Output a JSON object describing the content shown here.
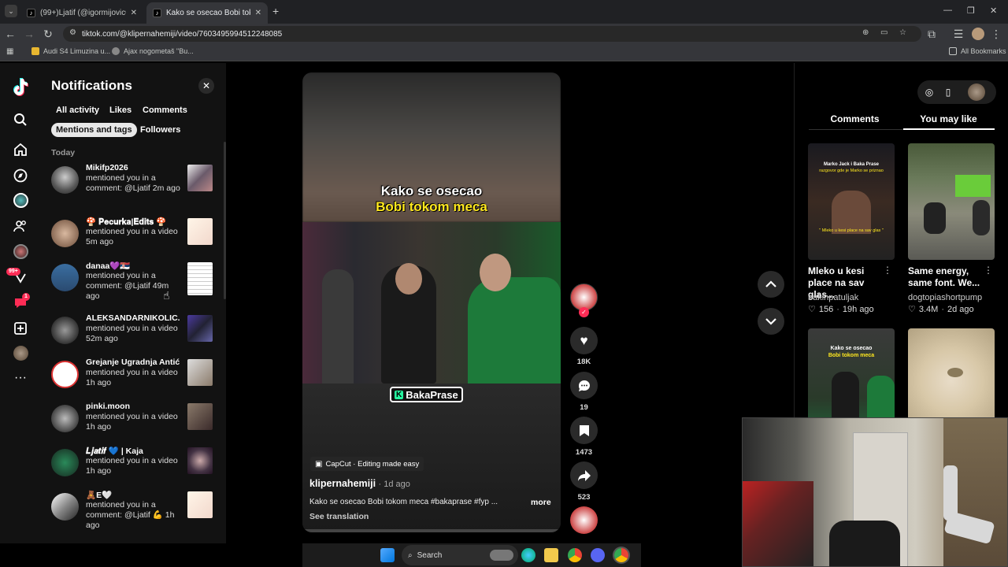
{
  "browser": {
    "tabs": [
      {
        "title": "(99+)Ljatif (@igormijovic00) | T",
        "active": false
      },
      {
        "title": "Kako se osecao Bobi tokom me",
        "active": true
      }
    ],
    "new_tab": "+",
    "url": "tiktok.com/@klipernahemiji/video/7603495994512248085",
    "bookmarks": [
      {
        "label": "Audi S4 Limuzina u..."
      },
      {
        "label": "Ajax nogometaš \"Bu..."
      }
    ],
    "all_bookmarks": "All Bookmarks"
  },
  "rail": {
    "badge_notifications": "99+",
    "badge_messages": "1"
  },
  "notifications": {
    "title": "Notifications",
    "filters": [
      "All activity",
      "Likes",
      "Comments",
      "Mentions and tags",
      "Followers"
    ],
    "selected_filter": "Mentions and tags",
    "section": "Today",
    "items": [
      {
        "name": "Mikifp2026",
        "text": "mentioned you in a comment: @Ljatif 2m ago"
      },
      {
        "name": "🍄 𝐏𝐞𝐜𝐮𝐫𝐤𝐚|𝐄𝐝𝐢𝐭𝐬 🍄",
        "text": "mentioned you in a video 5m ago"
      },
      {
        "name": "danaa💜🇷🇸",
        "text": "mentioned you in a comment: @Ljatif 49m ago"
      },
      {
        "name": "ALEKSANDARNIKOLIC...",
        "text": "mentioned you in a video 52m ago"
      },
      {
        "name": "Grejanje Ugradnja Antić",
        "text": "mentioned you in a video 1h ago"
      },
      {
        "name": "pinki.moon",
        "text": "mentioned you in a video 1h ago"
      },
      {
        "name": "𝑳𝒋𝒂𝒕𝒊𝒇 💙 | Kaja",
        "text": "mentioned you in a video 1h ago"
      },
      {
        "name": "🧸E🤍",
        "text": "mentioned you in a comment: @Ljatif 💪 1h ago"
      }
    ]
  },
  "video": {
    "caption_line1": "Kako se osecao",
    "caption_line2": "Bobi tokom meca",
    "watermark": "BakaPrase",
    "capcut": "CapCut · Editing made easy",
    "author": "klipernahemiji",
    "age": "· 1d ago",
    "description": "Kako se osecao Bobi tokom meca #bakaprase #fyp ...",
    "more": "more",
    "see_translation": "See translation"
  },
  "actions": {
    "likes": "18K",
    "comments": "19",
    "saves": "1473",
    "shares": "523"
  },
  "right_panel": {
    "tabs": [
      "Comments",
      "You may like"
    ],
    "active_tab": "You may like",
    "cards": [
      {
        "title": "Mleko u kesi place na sav glas...",
        "user": "bakinpatuljak",
        "likes": "156",
        "age": "19h ago",
        "overlay_top": "Marko Jack i Baka Prase",
        "overlay_sub": "razgovor gde je Marko se priznao",
        "overlay_bottom": "\" Mleko u kesi place na sav glas \""
      },
      {
        "title": "Same energy, same font. We...",
        "user": "dogtopiashortpump",
        "likes": "3.4M",
        "age": "2d ago"
      },
      {
        "title": "",
        "user": "",
        "likes": "",
        "age": "",
        "overlay_top": "Kako se osecao",
        "overlay_sub": "Bobi tokom meca"
      },
      {
        "title": "",
        "user": "",
        "likes": "",
        "age": ""
      }
    ]
  },
  "taskbar": {
    "search": "Search"
  },
  "colors": {
    "accent": "#fe2c55",
    "caption_yellow": "#ffe81f",
    "badge_green": "#25f4a0"
  }
}
